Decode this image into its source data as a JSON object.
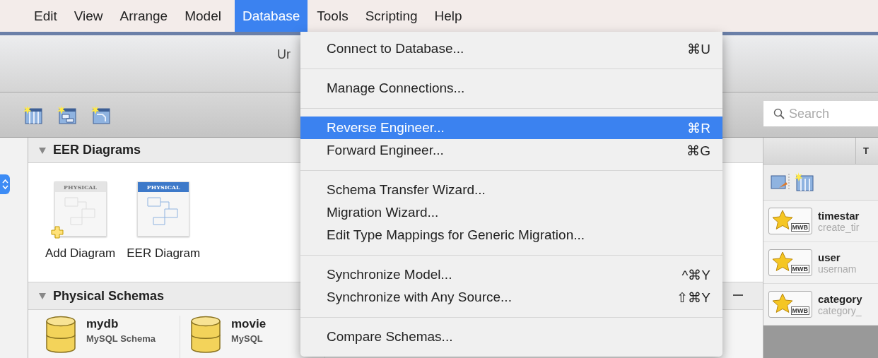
{
  "menu_bar": {
    "items": [
      {
        "label": "Edit",
        "selected": false
      },
      {
        "label": "View",
        "selected": false
      },
      {
        "label": "Arrange",
        "selected": false
      },
      {
        "label": "Model",
        "selected": false
      },
      {
        "label": "Database",
        "selected": true
      },
      {
        "label": "Tools",
        "selected": false
      },
      {
        "label": "Scripting",
        "selected": false
      },
      {
        "label": "Help",
        "selected": false
      }
    ]
  },
  "window": {
    "title": "Ur"
  },
  "toolbar": {
    "search": {
      "placeholder": "Search"
    }
  },
  "sections": [
    {
      "title": "EER Diagrams",
      "expanded": true
    },
    {
      "title": "Physical Schemas",
      "expanded": true
    }
  ],
  "diagrams": [
    {
      "label": "Add Diagram",
      "kind": "add",
      "icon_label": "PHYSICAL"
    },
    {
      "label": "EER Diagram",
      "kind": "diagram",
      "icon_label": "PHYSICAL"
    }
  ],
  "schemas": [
    {
      "name": "mydb",
      "type": "MySQL Schema"
    },
    {
      "name": "movie",
      "type": "MySQL"
    }
  ],
  "right_panel": {
    "tab": "T",
    "snippets": [
      {
        "title": "timestar",
        "detail": "create_tir",
        "badge": "MWB"
      },
      {
        "title": "user",
        "detail": "usernam",
        "badge": "MWB"
      },
      {
        "title": "category",
        "detail": "category_",
        "badge": "MWB"
      }
    ]
  },
  "dropdown": {
    "items": [
      {
        "kind": "item",
        "label": "Connect to Database...",
        "shortcut": "⌘U",
        "selected": false
      },
      {
        "kind": "separator"
      },
      {
        "kind": "item",
        "label": "Manage Connections...",
        "selected": false
      },
      {
        "kind": "separator"
      },
      {
        "kind": "item",
        "label": "Reverse Engineer...",
        "shortcut": "⌘R",
        "selected": true
      },
      {
        "kind": "item",
        "label": "Forward Engineer...",
        "shortcut": "⌘G",
        "selected": false
      },
      {
        "kind": "separator"
      },
      {
        "kind": "item",
        "label": "Schema Transfer Wizard...",
        "selected": false
      },
      {
        "kind": "item",
        "label": "Migration Wizard...",
        "selected": false
      },
      {
        "kind": "item",
        "label": "Edit Type Mappings for Generic Migration...",
        "selected": false
      },
      {
        "kind": "separator"
      },
      {
        "kind": "item",
        "label": "Synchronize Model...",
        "shortcut": "^⌘Y",
        "selected": false
      },
      {
        "kind": "item",
        "label": "Synchronize with Any Source...",
        "shortcut": "⇧⌘Y",
        "selected": false
      },
      {
        "kind": "separator"
      },
      {
        "kind": "item",
        "label": "Compare Schemas...",
        "selected": false
      }
    ]
  }
}
